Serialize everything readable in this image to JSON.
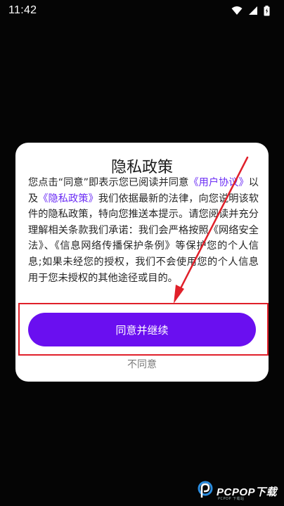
{
  "status_bar": {
    "time": "11:42",
    "icons": [
      "wifi-icon",
      "signal-icon",
      "battery-icon"
    ],
    "color": "#ffffff"
  },
  "dialog": {
    "title": "隐私政策",
    "body": {
      "part1": "您点击“同意”即表示您已阅读并同意",
      "link_user_agreement": "《用户协议》",
      "part2": "以及",
      "link_privacy_policy": "《隐私政策》",
      "part3": "我们依据最新的法律，向您说明该软件的隐私政策，特向您推送本提示。请您阅读并充分理解相关条款我们承诺：我们会严格按照《网络安全法》、《信息网络传播保护条例》等保护您的个人信息;如果未经您的授权，我们不会使用您的个人信息用于您未授权的其他途径或目的。"
    },
    "agree_label": "同意并继续",
    "disagree_label": "不同意"
  },
  "watermark": {
    "text": "PCPOP下载",
    "subtext": "PCPOP 下载站"
  },
  "colors": {
    "background": "#050505",
    "accent": "#6a0ff0",
    "link": "#6b2cf5",
    "highlight": "#e0202a"
  }
}
